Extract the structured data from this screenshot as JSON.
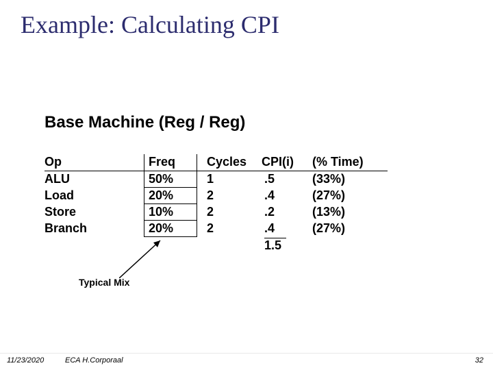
{
  "title": "Example: Calculating CPI",
  "subtitle": "Base Machine (Reg / Reg)",
  "headers": {
    "op": "Op",
    "freq": "Freq",
    "cycles": "Cycles",
    "cpii": "CPI(i)",
    "time": "(% Time)"
  },
  "rows": [
    {
      "op": "ALU",
      "freq": "50%",
      "cycles": "1",
      "cpii": ".5",
      "time": "(33%)"
    },
    {
      "op": "Load",
      "freq": "20%",
      "cycles": "2",
      "cpii": ".4",
      "time": "(27%)"
    },
    {
      "op": "Store",
      "freq": "10%",
      "cycles": "2",
      "cpii": ".2",
      "time": "(13%)"
    },
    {
      "op": "Branch",
      "freq": "20%",
      "cycles": "2",
      "cpii": ".4",
      "time": "(27%)"
    }
  ],
  "total_cpi": "1.5",
  "typical_mix_label": "Typical Mix",
  "footer": {
    "date": "11/23/2020",
    "author": "ECA  H.Corporaal",
    "pagenum": "32"
  },
  "chart_data": {
    "type": "table",
    "title": "Base Machine (Reg / Reg) — CPI calculation",
    "columns": [
      "Op",
      "Freq",
      "Cycles",
      "CPI(i)",
      "% Time"
    ],
    "rows": [
      [
        "ALU",
        0.5,
        1,
        0.5,
        0.33
      ],
      [
        "Load",
        0.2,
        2,
        0.4,
        0.27
      ],
      [
        "Store",
        0.1,
        2,
        0.2,
        0.13
      ],
      [
        "Branch",
        0.2,
        2,
        0.4,
        0.27
      ]
    ],
    "total_cpi": 1.5
  }
}
